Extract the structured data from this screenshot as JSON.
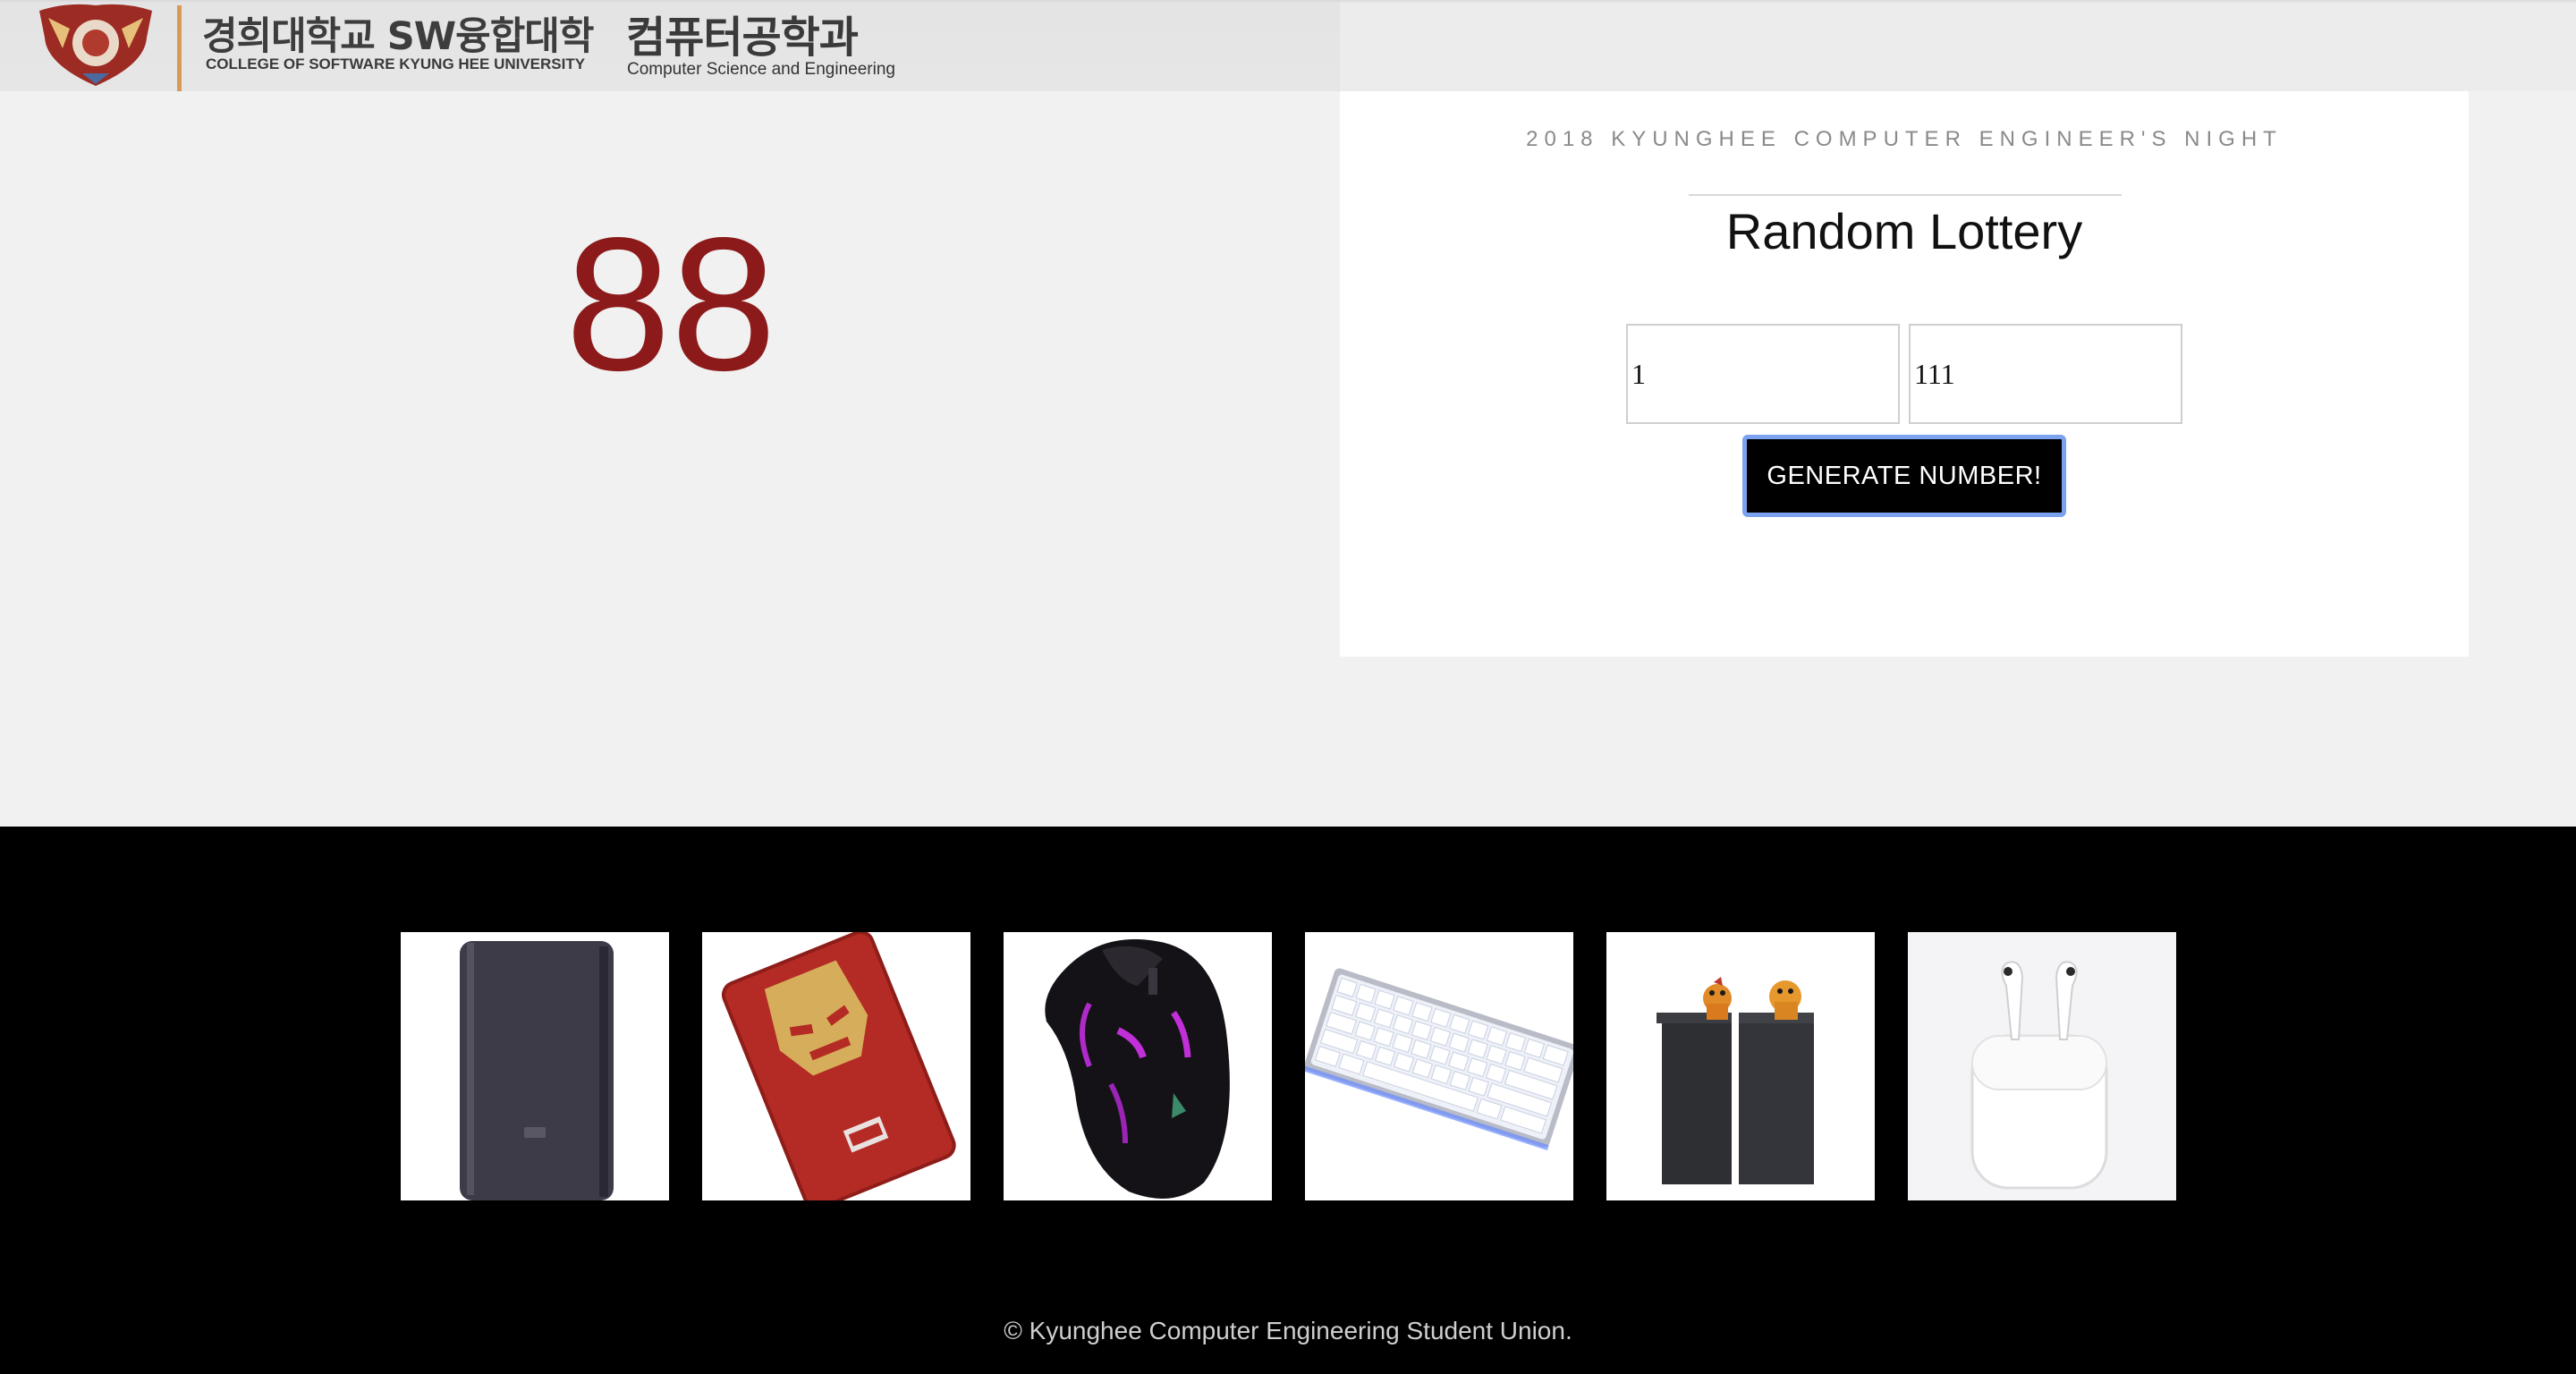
{
  "header": {
    "logo_icon": "university-emblem-icon",
    "college_kr": "경희대학교 SW융합대학",
    "college_en": "COLLEGE OF SOFTWARE KYUNG HEE UNIVERSITY",
    "dept_kr": "컴퓨터공학과",
    "dept_en": "Computer Science and Engineering",
    "accent_color": "#d99a56"
  },
  "result": {
    "number": "88",
    "color": "#8c1a1a"
  },
  "lottery": {
    "event_name": "2018 KYUNGHEE COMPUTER ENGINEER'S NIGHT",
    "title": "Random Lottery",
    "min_value": "1",
    "max_value": "111",
    "button_label": "GENERATE NUMBER!"
  },
  "prizes": [
    {
      "name": "power-bank",
      "icon": "power-bank-icon"
    },
    {
      "name": "iron-man-power-bank",
      "icon": "iron-man-power-bank-icon"
    },
    {
      "name": "gaming-mouse",
      "icon": "gaming-mouse-icon"
    },
    {
      "name": "keyboard",
      "icon": "keyboard-icon"
    },
    {
      "name": "speakers",
      "icon": "speakers-icon"
    },
    {
      "name": "airpods",
      "icon": "airpods-icon"
    }
  ],
  "footer": {
    "copyright": "© Kyunghee Computer Engineering Student Union."
  }
}
